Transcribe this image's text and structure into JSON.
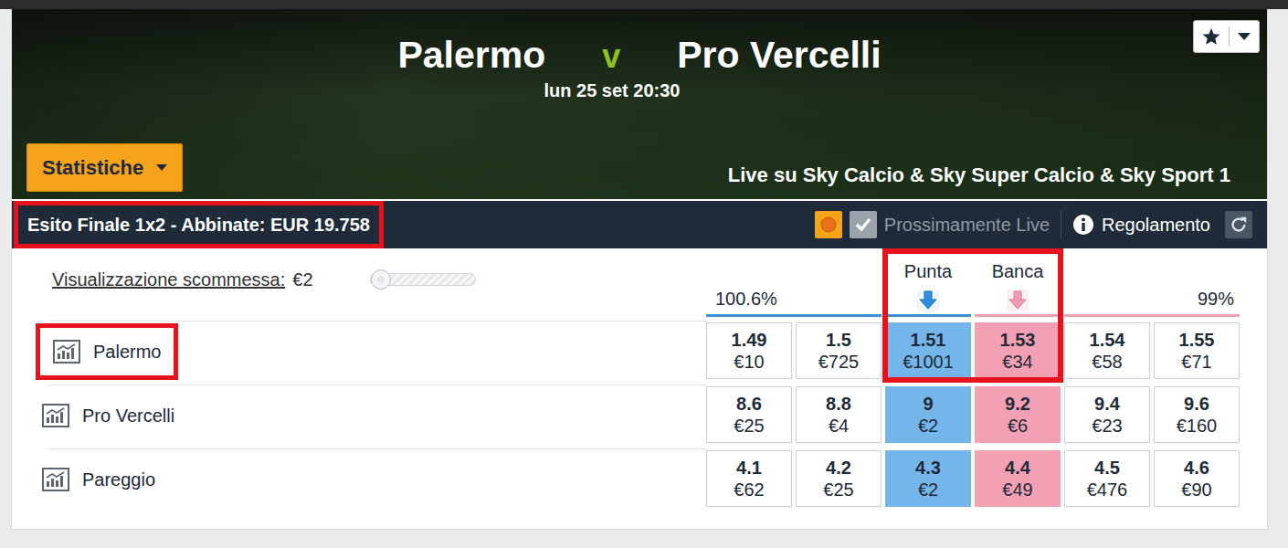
{
  "event": {
    "home": "Palermo",
    "separator": "v",
    "away": "Pro Vercelli",
    "datetime": "lun 25 set 20:30",
    "broadcast": "Live su Sky Calcio & Sky Super Calcio & Sky Sport 1"
  },
  "stats_button": {
    "label": "Statistiche"
  },
  "market": {
    "title": "Esito Finale 1x2 - Abbinate: EUR 19.758",
    "highlighted": true,
    "in_play_soon": "Prossimamente Live",
    "checked": true,
    "rules": "Regolamento"
  },
  "stake": {
    "label": "Visualizzazione scommessa:",
    "value": "€2",
    "level": 0
  },
  "book": {
    "back_percent": "100.6%",
    "lay_percent": "99%",
    "back_label": "Punta",
    "lay_label": "Banca",
    "highlighted": true
  },
  "runners": [
    {
      "name": "Palermo",
      "highlighted": true,
      "prices": [
        {
          "odds": "1.49",
          "amount": "€10",
          "kind": "back"
        },
        {
          "odds": "1.5",
          "amount": "€725",
          "kind": "back"
        },
        {
          "odds": "1.51",
          "amount": "€1001",
          "kind": "back-best"
        },
        {
          "odds": "1.53",
          "amount": "€34",
          "kind": "lay-best"
        },
        {
          "odds": "1.54",
          "amount": "€58",
          "kind": "lay"
        },
        {
          "odds": "1.55",
          "amount": "€71",
          "kind": "lay"
        }
      ]
    },
    {
      "name": "Pro Vercelli",
      "highlighted": false,
      "prices": [
        {
          "odds": "8.6",
          "amount": "€25",
          "kind": "back"
        },
        {
          "odds": "8.8",
          "amount": "€4",
          "kind": "back"
        },
        {
          "odds": "9",
          "amount": "€2",
          "kind": "back-best"
        },
        {
          "odds": "9.2",
          "amount": "€6",
          "kind": "lay-best"
        },
        {
          "odds": "9.4",
          "amount": "€23",
          "kind": "lay"
        },
        {
          "odds": "9.6",
          "amount": "€160",
          "kind": "lay"
        }
      ]
    },
    {
      "name": "Pareggio",
      "highlighted": false,
      "prices": [
        {
          "odds": "4.1",
          "amount": "€62",
          "kind": "back"
        },
        {
          "odds": "4.2",
          "amount": "€25",
          "kind": "back"
        },
        {
          "odds": "4.3",
          "amount": "€2",
          "kind": "back-best"
        },
        {
          "odds": "4.4",
          "amount": "€49",
          "kind": "lay-best"
        },
        {
          "odds": "4.5",
          "amount": "€476",
          "kind": "lay"
        },
        {
          "odds": "4.6",
          "amount": "€90",
          "kind": "lay"
        }
      ]
    }
  ]
}
